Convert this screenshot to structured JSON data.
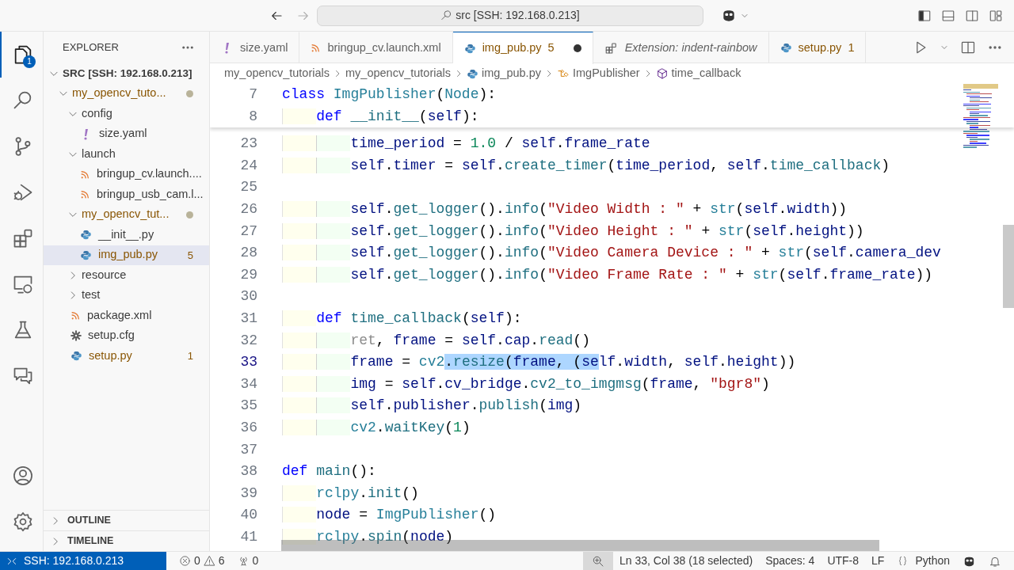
{
  "titlebar": {
    "search": "src [SSH: 192.168.0.213]"
  },
  "activity": [
    {
      "kind": "explorer",
      "selected": true,
      "badge": "1"
    },
    {
      "kind": "search",
      "selected": false
    },
    {
      "kind": "scm",
      "selected": false
    },
    {
      "kind": "debug",
      "selected": false
    },
    {
      "kind": "extensions",
      "selected": false
    },
    {
      "kind": "remote",
      "selected": false
    },
    {
      "kind": "testing",
      "selected": false
    },
    {
      "kind": "chat",
      "selected": false
    }
  ],
  "explorer": {
    "title": "EXPLORER",
    "root": {
      "label": "SRC [SSH: 192.168.0.213]",
      "expanded": true,
      "children": [
        {
          "label": "my_opencv_tuto...",
          "kind": "folder",
          "expanded": true,
          "selected": false,
          "problems": true,
          "dot": true,
          "children": [
            {
              "label": "config",
              "kind": "folder",
              "expanded": true,
              "selected": false,
              "problems": false,
              "dot": false,
              "children": [
                {
                  "label": "size.yaml",
                  "kind": "yaml",
                  "selected": false,
                  "problems": false,
                  "dot": false
                }
              ]
            },
            {
              "label": "launch",
              "kind": "folder",
              "expanded": true,
              "selected": false,
              "problems": false,
              "dot": false,
              "children": [
                {
                  "label": "bringup_cv.launch....",
                  "kind": "xml",
                  "selected": false,
                  "problems": false,
                  "dot": false
                },
                {
                  "label": "bringup_usb_cam.l...",
                  "kind": "xml",
                  "selected": false,
                  "problems": false,
                  "dot": false
                }
              ]
            },
            {
              "label": "my_opencv_tut...",
              "kind": "folder",
              "expanded": true,
              "selected": false,
              "problems": true,
              "dot": true,
              "children": [
                {
                  "label": "__init__.py",
                  "kind": "python",
                  "selected": false,
                  "problems": false,
                  "dot": false
                },
                {
                  "label": "img_pub.py",
                  "kind": "python",
                  "selected": true,
                  "problems": true,
                  "dot": false,
                  "badge": "5"
                }
              ]
            },
            {
              "label": "resource",
              "kind": "folder",
              "expanded": false,
              "selected": false,
              "problems": false,
              "dot": false
            },
            {
              "label": "test",
              "kind": "folder",
              "expanded": false,
              "selected": false,
              "problems": false,
              "dot": false
            },
            {
              "label": "package.xml",
              "kind": "xml",
              "selected": false,
              "problems": false,
              "dot": false
            },
            {
              "label": "setup.cfg",
              "kind": "config",
              "selected": false,
              "problems": false,
              "dot": false
            },
            {
              "label": "setup.py",
              "kind": "python",
              "selected": false,
              "problems": true,
              "dot": false,
              "badge": "1"
            }
          ]
        }
      ]
    },
    "sections": [
      {
        "label": "OUTLINE",
        "expanded": false
      },
      {
        "label": "TIMELINE",
        "expanded": false
      }
    ]
  },
  "tabs": [
    {
      "label": "size.yaml",
      "kind": "yaml",
      "selected": false,
      "dirty": false,
      "preview": false,
      "problems": false
    },
    {
      "label": "bringup_cv.launch.xml",
      "kind": "xml",
      "selected": false,
      "dirty": false,
      "preview": false,
      "problems": false
    },
    {
      "label": "img_pub.py",
      "kind": "python",
      "selected": true,
      "dirty": true,
      "preview": false,
      "problems": true,
      "badge": "5"
    },
    {
      "label": "Extension: indent-rainbow",
      "kind": "extension",
      "selected": false,
      "dirty": false,
      "preview": true,
      "problems": false
    },
    {
      "label": "setup.py",
      "kind": "python",
      "selected": false,
      "dirty": false,
      "preview": false,
      "problems": true,
      "badge": "1"
    }
  ],
  "breadcrumbs": [
    {
      "label": "my_opencv_tutorials",
      "kind": "folder"
    },
    {
      "label": "my_opencv_tutorials",
      "kind": "folder"
    },
    {
      "label": "img_pub.py",
      "kind": "python"
    },
    {
      "label": "ImgPublisher",
      "kind": "class"
    },
    {
      "label": "time_callback",
      "kind": "method"
    }
  ],
  "sticky_lines": [
    {
      "number": "7",
      "tokens": [
        {
          "text": "class ",
          "kind": "kw"
        },
        {
          "text": "ImgPublisher",
          "kind": "cls"
        },
        {
          "text": "(",
          "kind": "p"
        },
        {
          "text": "Node",
          "kind": "cls"
        },
        {
          "text": "):",
          "kind": "p"
        }
      ]
    },
    {
      "number": "8",
      "tokens": [
        {
          "text": "    def ",
          "kind": "kw"
        },
        {
          "text": "__init__",
          "kind": "fn"
        },
        {
          "text": "(",
          "kind": "p"
        },
        {
          "text": "self",
          "kind": "var"
        },
        {
          "text": "):",
          "kind": "p"
        }
      ]
    }
  ],
  "lines": [
    {
      "number": "23",
      "current": false,
      "tokens": [
        {
          "text": "        time_period",
          "kind": "var"
        },
        {
          "text": " = ",
          "kind": "p"
        },
        {
          "text": "1.0",
          "kind": "num"
        },
        {
          "text": " / ",
          "kind": "p"
        },
        {
          "text": "self",
          "kind": "var"
        },
        {
          "text": ".",
          "kind": "p"
        },
        {
          "text": "frame_rate",
          "kind": "var"
        }
      ]
    },
    {
      "number": "24",
      "current": false,
      "tokens": [
        {
          "text": "        self",
          "kind": "var"
        },
        {
          "text": ".",
          "kind": "p"
        },
        {
          "text": "timer",
          "kind": "var"
        },
        {
          "text": " = ",
          "kind": "p"
        },
        {
          "text": "self",
          "kind": "var"
        },
        {
          "text": ".",
          "kind": "p"
        },
        {
          "text": "create_timer",
          "kind": "fn"
        },
        {
          "text": "(",
          "kind": "p"
        },
        {
          "text": "time_period",
          "kind": "var"
        },
        {
          "text": ", ",
          "kind": "p"
        },
        {
          "text": "self",
          "kind": "var"
        },
        {
          "text": ".",
          "kind": "p"
        },
        {
          "text": "time_callback",
          "kind": "fn"
        },
        {
          "text": ")",
          "kind": "p"
        }
      ]
    },
    {
      "number": "25",
      "current": false
    },
    {
      "number": "26",
      "current": false,
      "tokens": [
        {
          "text": "        self",
          "kind": "var"
        },
        {
          "text": ".",
          "kind": "p"
        },
        {
          "text": "get_logger",
          "kind": "fn"
        },
        {
          "text": "().",
          "kind": "p"
        },
        {
          "text": "info",
          "kind": "fn"
        },
        {
          "text": "(",
          "kind": "p"
        },
        {
          "text": "\"Video Width : \"",
          "kind": "str"
        },
        {
          "text": " + ",
          "kind": "p"
        },
        {
          "text": "str",
          "kind": "cls"
        },
        {
          "text": "(",
          "kind": "p"
        },
        {
          "text": "self",
          "kind": "var"
        },
        {
          "text": ".",
          "kind": "p"
        },
        {
          "text": "width",
          "kind": "var"
        },
        {
          "text": "))",
          "kind": "p"
        }
      ]
    },
    {
      "number": "27",
      "current": false,
      "tokens": [
        {
          "text": "        self",
          "kind": "var"
        },
        {
          "text": ".",
          "kind": "p"
        },
        {
          "text": "get_logger",
          "kind": "fn"
        },
        {
          "text": "().",
          "kind": "p"
        },
        {
          "text": "info",
          "kind": "fn"
        },
        {
          "text": "(",
          "kind": "p"
        },
        {
          "text": "\"Video Height : \"",
          "kind": "str"
        },
        {
          "text": " + ",
          "kind": "p"
        },
        {
          "text": "str",
          "kind": "cls"
        },
        {
          "text": "(",
          "kind": "p"
        },
        {
          "text": "self",
          "kind": "var"
        },
        {
          "text": ".",
          "kind": "p"
        },
        {
          "text": "height",
          "kind": "var"
        },
        {
          "text": "))",
          "kind": "p"
        }
      ]
    },
    {
      "number": "28",
      "current": false,
      "tokens": [
        {
          "text": "        self",
          "kind": "var"
        },
        {
          "text": ".",
          "kind": "p"
        },
        {
          "text": "get_logger",
          "kind": "fn"
        },
        {
          "text": "().",
          "kind": "p"
        },
        {
          "text": "info",
          "kind": "fn"
        },
        {
          "text": "(",
          "kind": "p"
        },
        {
          "text": "\"Video Camera Device : \"",
          "kind": "str"
        },
        {
          "text": " + ",
          "kind": "p"
        },
        {
          "text": "str",
          "kind": "cls"
        },
        {
          "text": "(",
          "kind": "p"
        },
        {
          "text": "self",
          "kind": "var"
        },
        {
          "text": ".",
          "kind": "p"
        },
        {
          "text": "camera_dev",
          "kind": "var"
        }
      ]
    },
    {
      "number": "29",
      "current": false,
      "tokens": [
        {
          "text": "        self",
          "kind": "var"
        },
        {
          "text": ".",
          "kind": "p"
        },
        {
          "text": "get_logger",
          "kind": "fn"
        },
        {
          "text": "().",
          "kind": "p"
        },
        {
          "text": "info",
          "kind": "fn"
        },
        {
          "text": "(",
          "kind": "p"
        },
        {
          "text": "\"Video Frame Rate : \"",
          "kind": "str"
        },
        {
          "text": " + ",
          "kind": "p"
        },
        {
          "text": "str",
          "kind": "cls"
        },
        {
          "text": "(",
          "kind": "p"
        },
        {
          "text": "self",
          "kind": "var"
        },
        {
          "text": ".",
          "kind": "p"
        },
        {
          "text": "frame_rate",
          "kind": "var"
        },
        {
          "text": "))",
          "kind": "p"
        }
      ]
    },
    {
      "number": "30",
      "current": false
    },
    {
      "number": "31",
      "current": false,
      "tokens": [
        {
          "text": "    def ",
          "kind": "kw"
        },
        {
          "text": "time_callback",
          "kind": "fn"
        },
        {
          "text": "(",
          "kind": "p"
        },
        {
          "text": "self",
          "kind": "var"
        },
        {
          "text": "):",
          "kind": "p"
        }
      ]
    },
    {
      "number": "32",
      "current": false,
      "tokens": [
        {
          "text": "        ret",
          "kind": "dim"
        },
        {
          "text": ", ",
          "kind": "p"
        },
        {
          "text": "frame",
          "kind": "var"
        },
        {
          "text": " = ",
          "kind": "p"
        },
        {
          "text": "self",
          "kind": "var"
        },
        {
          "text": ".",
          "kind": "p"
        },
        {
          "text": "cap",
          "kind": "var"
        },
        {
          "text": ".",
          "kind": "p"
        },
        {
          "text": "read",
          "kind": "fn"
        },
        {
          "text": "()",
          "kind": "p"
        }
      ]
    },
    {
      "number": "33",
      "current": true,
      "tokens": [
        {
          "text": "        frame",
          "kind": "var"
        },
        {
          "text": " = ",
          "kind": "p"
        },
        {
          "text": "cv2",
          "kind": "cls"
        },
        {
          "text": ".",
          "kind": "p",
          "selected": true
        },
        {
          "text": "resize",
          "kind": "fn",
          "selected": true
        },
        {
          "text": "(",
          "kind": "p",
          "selected": true
        },
        {
          "text": "frame",
          "kind": "var",
          "selected": true
        },
        {
          "text": ", (",
          "kind": "p",
          "selected": true
        },
        {
          "text": "se",
          "kind": "var",
          "selected": true
        },
        {
          "text": "lf",
          "kind": "var"
        },
        {
          "text": ".",
          "kind": "p"
        },
        {
          "text": "width",
          "kind": "var"
        },
        {
          "text": ", ",
          "kind": "p"
        },
        {
          "text": "self",
          "kind": "var"
        },
        {
          "text": ".",
          "kind": "p"
        },
        {
          "text": "height",
          "kind": "var"
        },
        {
          "text": "))",
          "kind": "p"
        }
      ]
    },
    {
      "number": "34",
      "current": false,
      "tokens": [
        {
          "text": "        img",
          "kind": "var"
        },
        {
          "text": " = ",
          "kind": "p"
        },
        {
          "text": "self",
          "kind": "var"
        },
        {
          "text": ".",
          "kind": "p"
        },
        {
          "text": "cv_bridge",
          "kind": "var"
        },
        {
          "text": ".",
          "kind": "p"
        },
        {
          "text": "cv2_to_imgmsg",
          "kind": "fn"
        },
        {
          "text": "(",
          "kind": "p"
        },
        {
          "text": "frame",
          "kind": "var"
        },
        {
          "text": ", ",
          "kind": "p"
        },
        {
          "text": "\"bgr8\"",
          "kind": "str"
        },
        {
          "text": ")",
          "kind": "p"
        }
      ]
    },
    {
      "number": "35",
      "current": false,
      "tokens": [
        {
          "text": "        self",
          "kind": "var"
        },
        {
          "text": ".",
          "kind": "p"
        },
        {
          "text": "publisher",
          "kind": "var"
        },
        {
          "text": ".",
          "kind": "p"
        },
        {
          "text": "publish",
          "kind": "fn"
        },
        {
          "text": "(",
          "kind": "p"
        },
        {
          "text": "img",
          "kind": "var"
        },
        {
          "text": ")",
          "kind": "p"
        }
      ]
    },
    {
      "number": "36",
      "current": false,
      "tokens": [
        {
          "text": "        cv2",
          "kind": "cls"
        },
        {
          "text": ".",
          "kind": "p"
        },
        {
          "text": "waitKey",
          "kind": "fn"
        },
        {
          "text": "(",
          "kind": "p"
        },
        {
          "text": "1",
          "kind": "num"
        },
        {
          "text": ")",
          "kind": "p"
        }
      ]
    },
    {
      "number": "37",
      "current": false
    },
    {
      "number": "38",
      "current": false,
      "tokens": [
        {
          "text": "def ",
          "kind": "kw"
        },
        {
          "text": "main",
          "kind": "fn"
        },
        {
          "text": "():",
          "kind": "p"
        }
      ]
    },
    {
      "number": "39",
      "current": false,
      "tokens": [
        {
          "text": "    rclpy",
          "kind": "cls"
        },
        {
          "text": ".",
          "kind": "p"
        },
        {
          "text": "init",
          "kind": "fn"
        },
        {
          "text": "()",
          "kind": "p"
        }
      ]
    },
    {
      "number": "40",
      "current": false,
      "tokens": [
        {
          "text": "    node",
          "kind": "var"
        },
        {
          "text": " = ",
          "kind": "p"
        },
        {
          "text": "ImgPublisher",
          "kind": "cls"
        },
        {
          "text": "()",
          "kind": "p"
        }
      ]
    },
    {
      "number": "41",
      "current": false,
      "tokens": [
        {
          "text": "    rclpy",
          "kind": "cls"
        },
        {
          "text": ".",
          "kind": "p"
        },
        {
          "text": "spin",
          "kind": "fn"
        },
        {
          "text": "(",
          "kind": "p"
        },
        {
          "text": "node",
          "kind": "var"
        },
        {
          "text": ")",
          "kind": "p"
        }
      ]
    }
  ],
  "status_bar": {
    "remote": "SSH: 192.168.0.213",
    "errors": "0",
    "warnings": "6",
    "ports": "0",
    "position": "Ln 33, Col 38 (18 selected)",
    "indent": "Spaces: 4",
    "encoding": "UTF-8",
    "eol": "LF",
    "language": "Python"
  }
}
